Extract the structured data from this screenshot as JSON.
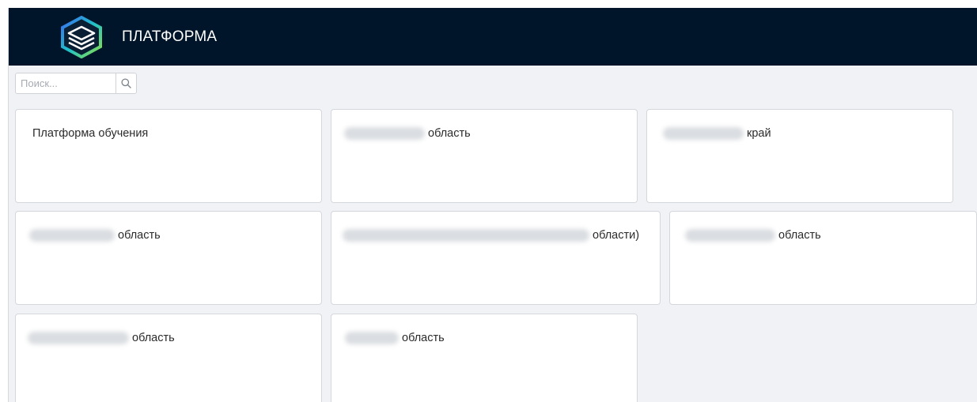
{
  "header": {
    "brand": "ПЛАТФОРМА",
    "logo_icon": "layers-logo-icon",
    "background_color": "#001529"
  },
  "search": {
    "placeholder": "Поиск...",
    "value": "",
    "icon": "search-icon"
  },
  "cards": [
    {
      "suffix": "Платформа обучения",
      "redacted": false
    },
    {
      "suffix": "область",
      "redacted": true
    },
    {
      "suffix": "край",
      "redacted": true
    },
    {
      "suffix": "область",
      "redacted": true
    },
    {
      "suffix": "области)",
      "redacted": true
    },
    {
      "suffix": "область",
      "redacted": true
    },
    {
      "suffix": "область",
      "redacted": true
    },
    {
      "suffix": "область",
      "redacted": true
    }
  ]
}
